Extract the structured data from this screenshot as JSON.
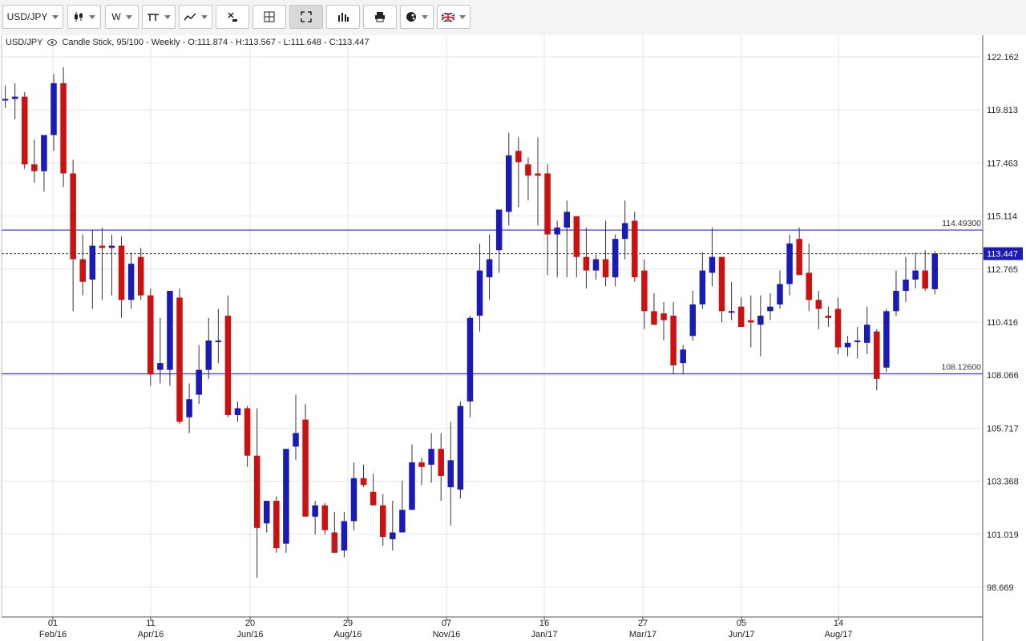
{
  "toolbar": {
    "symbol": "USD/JPY",
    "interval": "W",
    "buttons": [
      {
        "name": "chart-type-button",
        "icon": "candlestick-icon",
        "has_menu": true
      },
      {
        "name": "interval-button",
        "label": "W",
        "has_menu": true
      },
      {
        "name": "indicators-button",
        "icon": "indicators-icon",
        "has_menu": true
      },
      {
        "name": "drawing-tools-button",
        "icon": "trend-line-icon",
        "has_menu": true
      },
      {
        "name": "remove-all-button",
        "icon": "remove-all-icon",
        "has_menu": false
      },
      {
        "name": "crosshair-button",
        "icon": "crosshair-icon",
        "has_menu": false
      },
      {
        "name": "fullscreen-button",
        "icon": "fullscreen-icon",
        "has_menu": false,
        "active": true
      },
      {
        "name": "bars-button",
        "icon": "bars-icon",
        "has_menu": false
      },
      {
        "name": "print-button",
        "icon": "print-icon",
        "has_menu": false
      },
      {
        "name": "theme-button",
        "icon": "palette-icon",
        "has_menu": true
      },
      {
        "name": "language-button",
        "icon": "uk-flag-icon",
        "has_menu": true
      }
    ]
  },
  "legend": {
    "symbol": "USD/JPY",
    "description": "Candle Stick, 95/100 - Weekly - O:111.874 - H:113.567 - L:111.648 - C:113.447"
  },
  "colors": {
    "up": "#1a1ab4",
    "down": "#cc1111",
    "level_line": "#3d3dd9",
    "grid": "#e6e6e6",
    "current_tag": "#1a1ab4"
  },
  "chart_data": {
    "type": "candlestick",
    "y_ticks": [
      "122.162",
      "119.813",
      "117.463",
      "115.114",
      "112.765",
      "110.416",
      "108.066",
      "105.717",
      "103.368",
      "101.019",
      "98.669"
    ],
    "ylim": [
      97.8,
      123.5
    ],
    "x_ticks": [
      {
        "day": "01",
        "month": "Feb/16",
        "index": 8
      },
      {
        "day": "11",
        "month": "Apr/16",
        "index": 18
      },
      {
        "day": "20",
        "month": "Jun/16",
        "index": 28
      },
      {
        "day": "29",
        "month": "Aug/16",
        "index": 38
      },
      {
        "day": "07",
        "month": "Nov/16",
        "index": 48
      },
      {
        "day": "16",
        "month": "Jan/17",
        "index": 58
      },
      {
        "day": "27",
        "month": "Mar/17",
        "index": 68
      },
      {
        "day": "05",
        "month": "Jun/17",
        "index": 78
      },
      {
        "day": "14",
        "month": "Aug/17",
        "index": 88
      }
    ],
    "levels": [
      {
        "value": 114.493,
        "label": "114.49300"
      },
      {
        "value": 108.126,
        "label": "108.12600"
      }
    ],
    "current": {
      "value": 113.447,
      "label": "113.447"
    },
    "first_index": 3,
    "candles": [
      [
        120.3,
        120.9,
        119.9,
        120.3
      ],
      [
        120.3,
        121.0,
        119.4,
        120.4
      ],
      [
        120.4,
        120.6,
        117.2,
        117.4
      ],
      [
        117.4,
        118.5,
        116.6,
        117.1
      ],
      [
        117.1,
        118.5,
        116.2,
        118.7
      ],
      [
        118.7,
        121.4,
        118.0,
        121.0
      ],
      [
        121.0,
        121.7,
        116.4,
        117.0
      ],
      [
        117.0,
        117.6,
        110.9,
        113.2
      ],
      [
        113.2,
        114.3,
        111.6,
        112.2
      ],
      [
        112.3,
        114.5,
        111.0,
        113.8
      ],
      [
        113.8,
        114.6,
        111.4,
        113.7
      ],
      [
        113.7,
        114.3,
        111.6,
        113.8
      ],
      [
        113.8,
        114.2,
        110.6,
        111.4
      ],
      [
        111.4,
        113.5,
        111.0,
        113.0
      ],
      [
        113.3,
        113.7,
        111.4,
        111.6
      ],
      [
        111.6,
        111.9,
        107.6,
        108.1
      ],
      [
        108.3,
        110.6,
        107.7,
        108.6
      ],
      [
        108.3,
        111.8,
        107.6,
        111.8
      ],
      [
        111.5,
        111.9,
        105.9,
        106.0
      ],
      [
        106.2,
        107.7,
        105.5,
        107.0
      ],
      [
        107.2,
        109.4,
        106.8,
        108.3
      ],
      [
        108.3,
        110.6,
        107.9,
        109.6
      ],
      [
        109.6,
        111.0,
        108.6,
        109.6
      ],
      [
        110.7,
        111.6,
        106.2,
        106.3
      ],
      [
        106.3,
        106.9,
        106.0,
        106.6
      ],
      [
        106.6,
        106.7,
        104.0,
        104.5
      ],
      [
        104.5,
        106.6,
        99.1,
        101.3
      ],
      [
        101.5,
        102.2,
        101.1,
        102.5
      ],
      [
        102.5,
        102.7,
        100.2,
        100.4
      ],
      [
        100.6,
        101.8,
        100.2,
        104.8
      ],
      [
        104.9,
        107.2,
        104.3,
        105.5
      ],
      [
        106.1,
        106.8,
        102.6,
        101.8
      ],
      [
        101.8,
        102.5,
        101.0,
        102.3
      ],
      [
        102.3,
        102.4,
        101.0,
        101.2
      ],
      [
        101.1,
        102.0,
        100.2,
        100.2
      ],
      [
        100.3,
        102.0,
        100.0,
        101.6
      ],
      [
        101.6,
        104.2,
        101.2,
        103.5
      ],
      [
        103.5,
        104.1,
        103.1,
        103.2
      ],
      [
        102.9,
        103.7,
        102.6,
        102.3
      ],
      [
        102.3,
        102.8,
        100.5,
        100.9
      ],
      [
        100.8,
        102.5,
        100.3,
        101.1
      ],
      [
        101.1,
        103.4,
        101.8,
        102.1
      ],
      [
        102.1,
        105.0,
        103.0,
        104.2
      ],
      [
        104.2,
        104.4,
        103.2,
        104.0
      ],
      [
        104.1,
        105.5,
        103.3,
        104.8
      ],
      [
        104.8,
        105.5,
        102.5,
        103.6
      ],
      [
        103.1,
        106.0,
        101.4,
        104.3
      ],
      [
        103.0,
        106.9,
        102.6,
        106.7
      ],
      [
        106.9,
        110.7,
        106.2,
        110.6
      ],
      [
        110.7,
        113.9,
        110.0,
        112.7
      ],
      [
        112.4,
        114.3,
        111.4,
        113.2
      ],
      [
        113.6,
        115.2,
        112.6,
        115.4
      ],
      [
        115.3,
        118.8,
        114.7,
        117.8
      ],
      [
        118.0,
        118.6,
        115.5,
        117.5
      ],
      [
        117.4,
        117.7,
        115.8,
        116.9
      ],
      [
        117.0,
        118.6,
        114.7,
        116.9
      ],
      [
        117.0,
        117.4,
        112.5,
        114.3
      ],
      [
        114.3,
        114.9,
        112.4,
        114.6
      ],
      [
        114.6,
        115.8,
        112.4,
        115.3
      ],
      [
        115.1,
        114.9,
        112.4,
        113.3
      ],
      [
        113.3,
        114.6,
        111.9,
        112.7
      ],
      [
        112.7,
        113.4,
        112.3,
        113.2
      ],
      [
        113.2,
        114.9,
        112.0,
        112.4
      ],
      [
        112.4,
        114.3,
        112.0,
        114.1
      ],
      [
        114.1,
        115.8,
        113.2,
        114.8
      ],
      [
        114.9,
        115.3,
        112.2,
        112.4
      ],
      [
        112.7,
        113.2,
        110.1,
        110.9
      ],
      [
        110.9,
        111.7,
        110.4,
        110.3
      ],
      [
        110.8,
        111.3,
        109.6,
        110.5
      ],
      [
        110.7,
        111.3,
        108.1,
        108.5
      ],
      [
        108.6,
        109.4,
        108.1,
        109.2
      ],
      [
        109.8,
        111.8,
        109.6,
        111.2
      ],
      [
        111.2,
        113.5,
        111.0,
        112.7
      ],
      [
        112.6,
        114.6,
        112.0,
        113.3
      ],
      [
        113.3,
        113.3,
        110.4,
        110.9
      ],
      [
        110.9,
        112.2,
        110.5,
        110.9
      ],
      [
        111.1,
        111.5,
        110.3,
        110.2
      ],
      [
        110.5,
        111.6,
        109.3,
        110.4
      ],
      [
        110.3,
        111.6,
        108.9,
        110.7
      ],
      [
        110.9,
        111.7,
        110.5,
        111.1
      ],
      [
        111.2,
        112.7,
        111.0,
        112.1
      ],
      [
        112.1,
        114.3,
        111.6,
        113.9
      ],
      [
        114.1,
        114.6,
        112.5,
        112.5
      ],
      [
        112.6,
        113.9,
        110.9,
        111.4
      ],
      [
        111.4,
        111.8,
        110.1,
        111.0
      ],
      [
        110.7,
        111.1,
        110.2,
        110.6
      ],
      [
        111.0,
        111.5,
        109.0,
        109.3
      ],
      [
        109.3,
        109.8,
        108.9,
        109.5
      ],
      [
        109.6,
        110.2,
        108.8,
        109.6
      ],
      [
        109.5,
        111.1,
        109.0,
        110.3
      ],
      [
        110.0,
        110.1,
        107.4,
        107.9
      ],
      [
        108.4,
        111.0,
        108.2,
        110.9
      ],
      [
        110.9,
        112.7,
        110.7,
        111.8
      ],
      [
        111.8,
        113.3,
        111.3,
        112.3
      ],
      [
        112.3,
        113.5,
        111.9,
        112.7
      ],
      [
        112.7,
        113.6,
        111.8,
        111.9
      ],
      [
        111.874,
        113.567,
        111.648,
        113.447
      ]
    ]
  }
}
